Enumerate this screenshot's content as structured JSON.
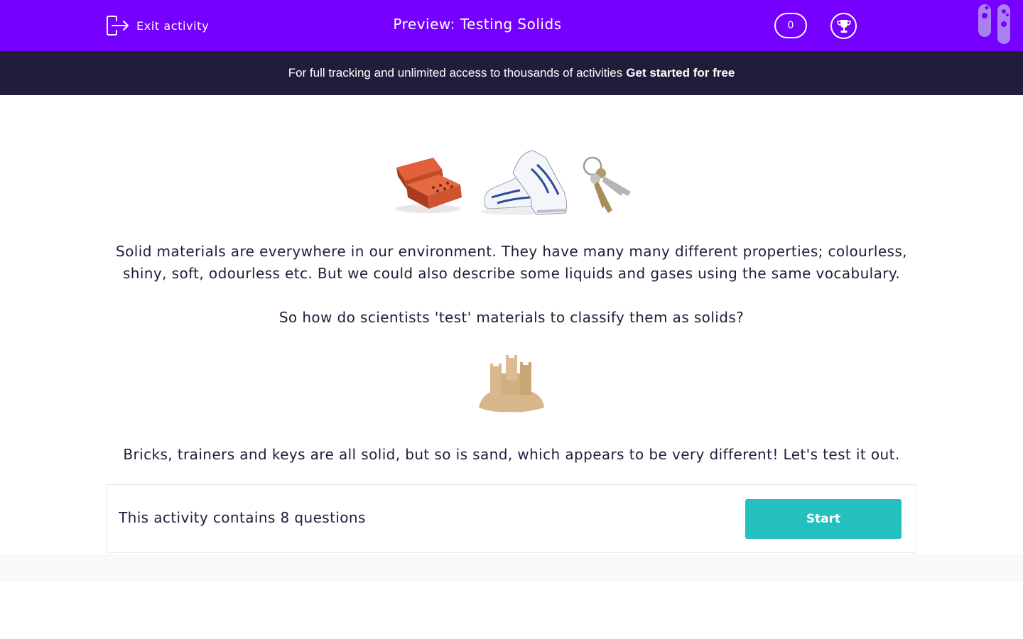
{
  "header": {
    "exit_label": "Exit activity",
    "title": "Preview: Testing Solids",
    "score": "0",
    "background_color": "#7600ff"
  },
  "banner": {
    "text": "For full tracking and unlimited access to thousands of activities",
    "link_label": "Get started for free"
  },
  "content": {
    "images": [
      "bricks",
      "trainers",
      "keys"
    ],
    "paragraph1": "Solid materials are everywhere in our environment. They have many many different properties; colourless, shiny, soft, odourless etc. But we could also describe some liquids and gases using the same vocabulary.",
    "paragraph2": "So how do scientists 'test' materials to classify them as solids?",
    "image2": "sandcastle",
    "paragraph3": "Bricks, trainers and keys are all solid, but so is sand, which appears to be very different!  Let's test it out."
  },
  "activity_card": {
    "text": "This activity contains 8 questions",
    "start_label": "Start",
    "start_color": "#24bfbf"
  },
  "icons": [
    "exit-icon",
    "trophy-icon",
    "test-tubes-icon"
  ]
}
